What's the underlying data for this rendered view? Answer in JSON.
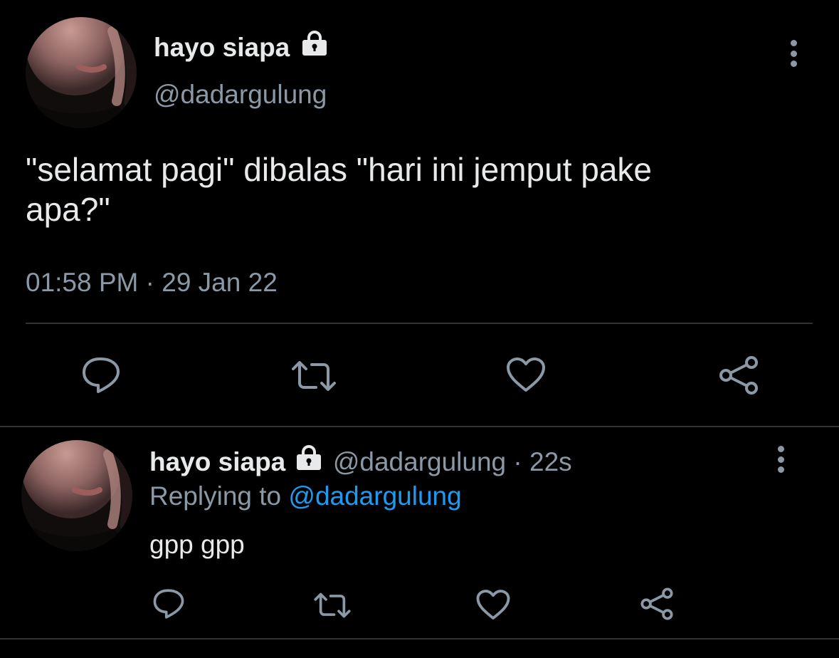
{
  "main_tweet": {
    "display_name": "hayo siapa",
    "handle": "@dadargulung",
    "text_line1": "\"selamat pagi\" dibalas \"hari ini jemput pake",
    "text_line2": "apa?\"",
    "timestamp": "01:58 PM · 29 Jan 22",
    "icons": {
      "lock": "lock-icon",
      "more": "more-vertical-icon",
      "reply": "reply-icon",
      "retweet": "retweet-icon",
      "like": "heart-icon",
      "share": "share-icon"
    }
  },
  "reply_tweet": {
    "display_name": "hayo siapa",
    "handle": "@dadargulung",
    "separator": "·",
    "age": "22s",
    "replying_prefix": "Replying to",
    "replying_handle": "@dadargulung",
    "text": "gpp gpp"
  },
  "colors": {
    "background": "#000000",
    "primary_text": "#e7e9ea",
    "secondary_text": "#8b98a5",
    "link": "#1d9bf0",
    "divider": "#2f3336"
  }
}
